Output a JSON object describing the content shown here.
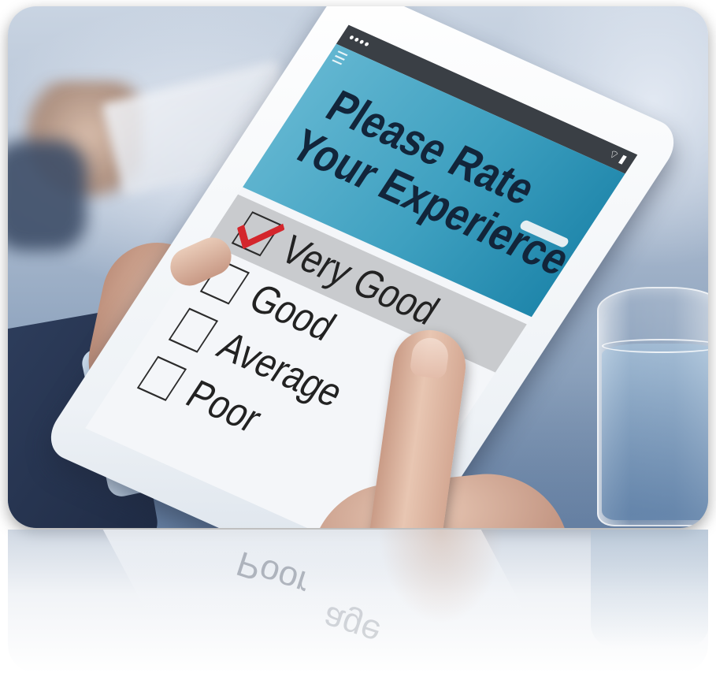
{
  "tablet": {
    "status_dots": "●●●●",
    "status_icons": "⌔ ▮",
    "title_line1": "Please Rate",
    "title_line2": "Your Experierce"
  },
  "rating": {
    "options": [
      {
        "label": "Very Good",
        "checked": true
      },
      {
        "label": "Good",
        "checked": false
      },
      {
        "label": "Average",
        "checked": false
      },
      {
        "label": "Poor",
        "checked": false
      }
    ]
  },
  "reflection": {
    "text1": "Poor",
    "text2": "age"
  },
  "colors": {
    "header_blue": "#3ea0c0",
    "check_red": "#d4262c",
    "selected_row": "#c9cbce"
  }
}
